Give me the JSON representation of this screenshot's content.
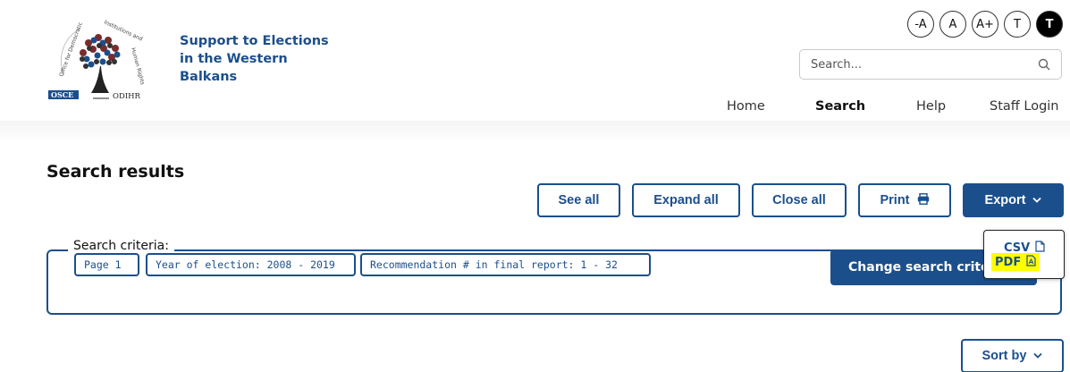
{
  "header": {
    "logo": {
      "icon": "osce-odihr-logo",
      "org_text": "ODIHR",
      "osce_text": "OSCE",
      "arc_text": "Office for Democratic Institutions and Human Rights"
    },
    "site_title_lines": [
      "Support to Elections",
      "in the Western",
      "Balkans"
    ]
  },
  "font_controls": [
    {
      "label": "-A",
      "name": "font-decrease-button"
    },
    {
      "label": "A",
      "name": "font-reset-button"
    },
    {
      "label": "A+",
      "name": "font-increase-button"
    },
    {
      "label": "T",
      "name": "text-only-button"
    },
    {
      "label": "T",
      "name": "high-contrast-button"
    }
  ],
  "search": {
    "placeholder": "Search...",
    "icon": "search-icon"
  },
  "nav": {
    "home": "Home",
    "search": "Search",
    "help": "Help",
    "staff_login": "Staff Login"
  },
  "results": {
    "title": "Search results",
    "buttons": {
      "see_all": "See all",
      "expand_all": "Expand all",
      "close_all": "Close all",
      "print": "Print",
      "export": "Export",
      "sort_by": "Sort by"
    },
    "criteria": {
      "legend": "Search criteria:",
      "chips": [
        "Page 1",
        "Year of election: 2008 - 2019",
        "Recommendation # in final report: 1 - 32"
      ],
      "change_button": "Change search criteria"
    },
    "export_menu": {
      "csv": "CSV",
      "pdf": "PDF"
    }
  },
  "colors": {
    "brand": "#1b4f8c",
    "highlight": "#ffff00"
  }
}
